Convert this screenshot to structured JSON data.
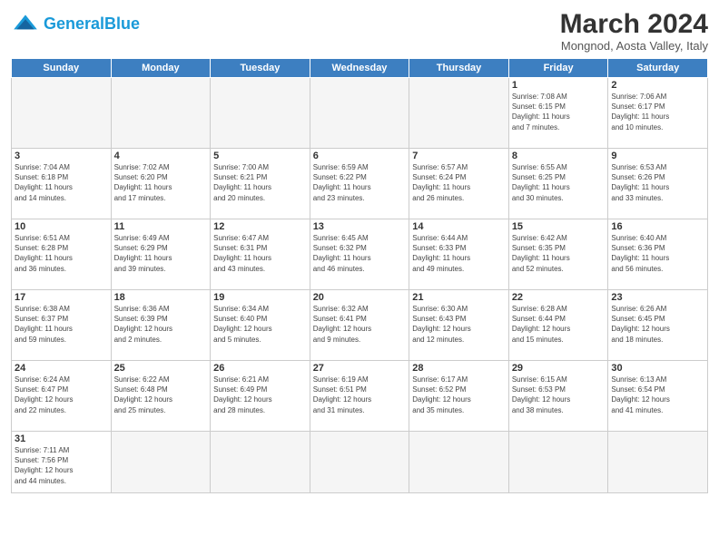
{
  "logo": {
    "text_general": "General",
    "text_blue": "Blue"
  },
  "title": "March 2024",
  "subtitle": "Mongnod, Aosta Valley, Italy",
  "header": {
    "days": [
      "Sunday",
      "Monday",
      "Tuesday",
      "Wednesday",
      "Thursday",
      "Friday",
      "Saturday"
    ]
  },
  "weeks": [
    {
      "cells": [
        {
          "day": "",
          "info": ""
        },
        {
          "day": "",
          "info": ""
        },
        {
          "day": "",
          "info": ""
        },
        {
          "day": "",
          "info": ""
        },
        {
          "day": "",
          "info": ""
        },
        {
          "day": "1",
          "info": "Sunrise: 7:08 AM\nSunset: 6:15 PM\nDaylight: 11 hours\nand 7 minutes."
        },
        {
          "day": "2",
          "info": "Sunrise: 7:06 AM\nSunset: 6:17 PM\nDaylight: 11 hours\nand 10 minutes."
        }
      ]
    },
    {
      "cells": [
        {
          "day": "3",
          "info": "Sunrise: 7:04 AM\nSunset: 6:18 PM\nDaylight: 11 hours\nand 14 minutes."
        },
        {
          "day": "4",
          "info": "Sunrise: 7:02 AM\nSunset: 6:20 PM\nDaylight: 11 hours\nand 17 minutes."
        },
        {
          "day": "5",
          "info": "Sunrise: 7:00 AM\nSunset: 6:21 PM\nDaylight: 11 hours\nand 20 minutes."
        },
        {
          "day": "6",
          "info": "Sunrise: 6:59 AM\nSunset: 6:22 PM\nDaylight: 11 hours\nand 23 minutes."
        },
        {
          "day": "7",
          "info": "Sunrise: 6:57 AM\nSunset: 6:24 PM\nDaylight: 11 hours\nand 26 minutes."
        },
        {
          "day": "8",
          "info": "Sunrise: 6:55 AM\nSunset: 6:25 PM\nDaylight: 11 hours\nand 30 minutes."
        },
        {
          "day": "9",
          "info": "Sunrise: 6:53 AM\nSunset: 6:26 PM\nDaylight: 11 hours\nand 33 minutes."
        }
      ]
    },
    {
      "cells": [
        {
          "day": "10",
          "info": "Sunrise: 6:51 AM\nSunset: 6:28 PM\nDaylight: 11 hours\nand 36 minutes."
        },
        {
          "day": "11",
          "info": "Sunrise: 6:49 AM\nSunset: 6:29 PM\nDaylight: 11 hours\nand 39 minutes."
        },
        {
          "day": "12",
          "info": "Sunrise: 6:47 AM\nSunset: 6:31 PM\nDaylight: 11 hours\nand 43 minutes."
        },
        {
          "day": "13",
          "info": "Sunrise: 6:45 AM\nSunset: 6:32 PM\nDaylight: 11 hours\nand 46 minutes."
        },
        {
          "day": "14",
          "info": "Sunrise: 6:44 AM\nSunset: 6:33 PM\nDaylight: 11 hours\nand 49 minutes."
        },
        {
          "day": "15",
          "info": "Sunrise: 6:42 AM\nSunset: 6:35 PM\nDaylight: 11 hours\nand 52 minutes."
        },
        {
          "day": "16",
          "info": "Sunrise: 6:40 AM\nSunset: 6:36 PM\nDaylight: 11 hours\nand 56 minutes."
        }
      ]
    },
    {
      "cells": [
        {
          "day": "17",
          "info": "Sunrise: 6:38 AM\nSunset: 6:37 PM\nDaylight: 11 hours\nand 59 minutes."
        },
        {
          "day": "18",
          "info": "Sunrise: 6:36 AM\nSunset: 6:39 PM\nDaylight: 12 hours\nand 2 minutes."
        },
        {
          "day": "19",
          "info": "Sunrise: 6:34 AM\nSunset: 6:40 PM\nDaylight: 12 hours\nand 5 minutes."
        },
        {
          "day": "20",
          "info": "Sunrise: 6:32 AM\nSunset: 6:41 PM\nDaylight: 12 hours\nand 9 minutes."
        },
        {
          "day": "21",
          "info": "Sunrise: 6:30 AM\nSunset: 6:43 PM\nDaylight: 12 hours\nand 12 minutes."
        },
        {
          "day": "22",
          "info": "Sunrise: 6:28 AM\nSunset: 6:44 PM\nDaylight: 12 hours\nand 15 minutes."
        },
        {
          "day": "23",
          "info": "Sunrise: 6:26 AM\nSunset: 6:45 PM\nDaylight: 12 hours\nand 18 minutes."
        }
      ]
    },
    {
      "cells": [
        {
          "day": "24",
          "info": "Sunrise: 6:24 AM\nSunset: 6:47 PM\nDaylight: 12 hours\nand 22 minutes."
        },
        {
          "day": "25",
          "info": "Sunrise: 6:22 AM\nSunset: 6:48 PM\nDaylight: 12 hours\nand 25 minutes."
        },
        {
          "day": "26",
          "info": "Sunrise: 6:21 AM\nSunset: 6:49 PM\nDaylight: 12 hours\nand 28 minutes."
        },
        {
          "day": "27",
          "info": "Sunrise: 6:19 AM\nSunset: 6:51 PM\nDaylight: 12 hours\nand 31 minutes."
        },
        {
          "day": "28",
          "info": "Sunrise: 6:17 AM\nSunset: 6:52 PM\nDaylight: 12 hours\nand 35 minutes."
        },
        {
          "day": "29",
          "info": "Sunrise: 6:15 AM\nSunset: 6:53 PM\nDaylight: 12 hours\nand 38 minutes."
        },
        {
          "day": "30",
          "info": "Sunrise: 6:13 AM\nSunset: 6:54 PM\nDaylight: 12 hours\nand 41 minutes."
        }
      ]
    },
    {
      "cells": [
        {
          "day": "31",
          "info": "Sunrise: 7:11 AM\nSunset: 7:56 PM\nDaylight: 12 hours\nand 44 minutes."
        },
        {
          "day": "",
          "info": ""
        },
        {
          "day": "",
          "info": ""
        },
        {
          "day": "",
          "info": ""
        },
        {
          "day": "",
          "info": ""
        },
        {
          "day": "",
          "info": ""
        },
        {
          "day": "",
          "info": ""
        }
      ]
    }
  ]
}
